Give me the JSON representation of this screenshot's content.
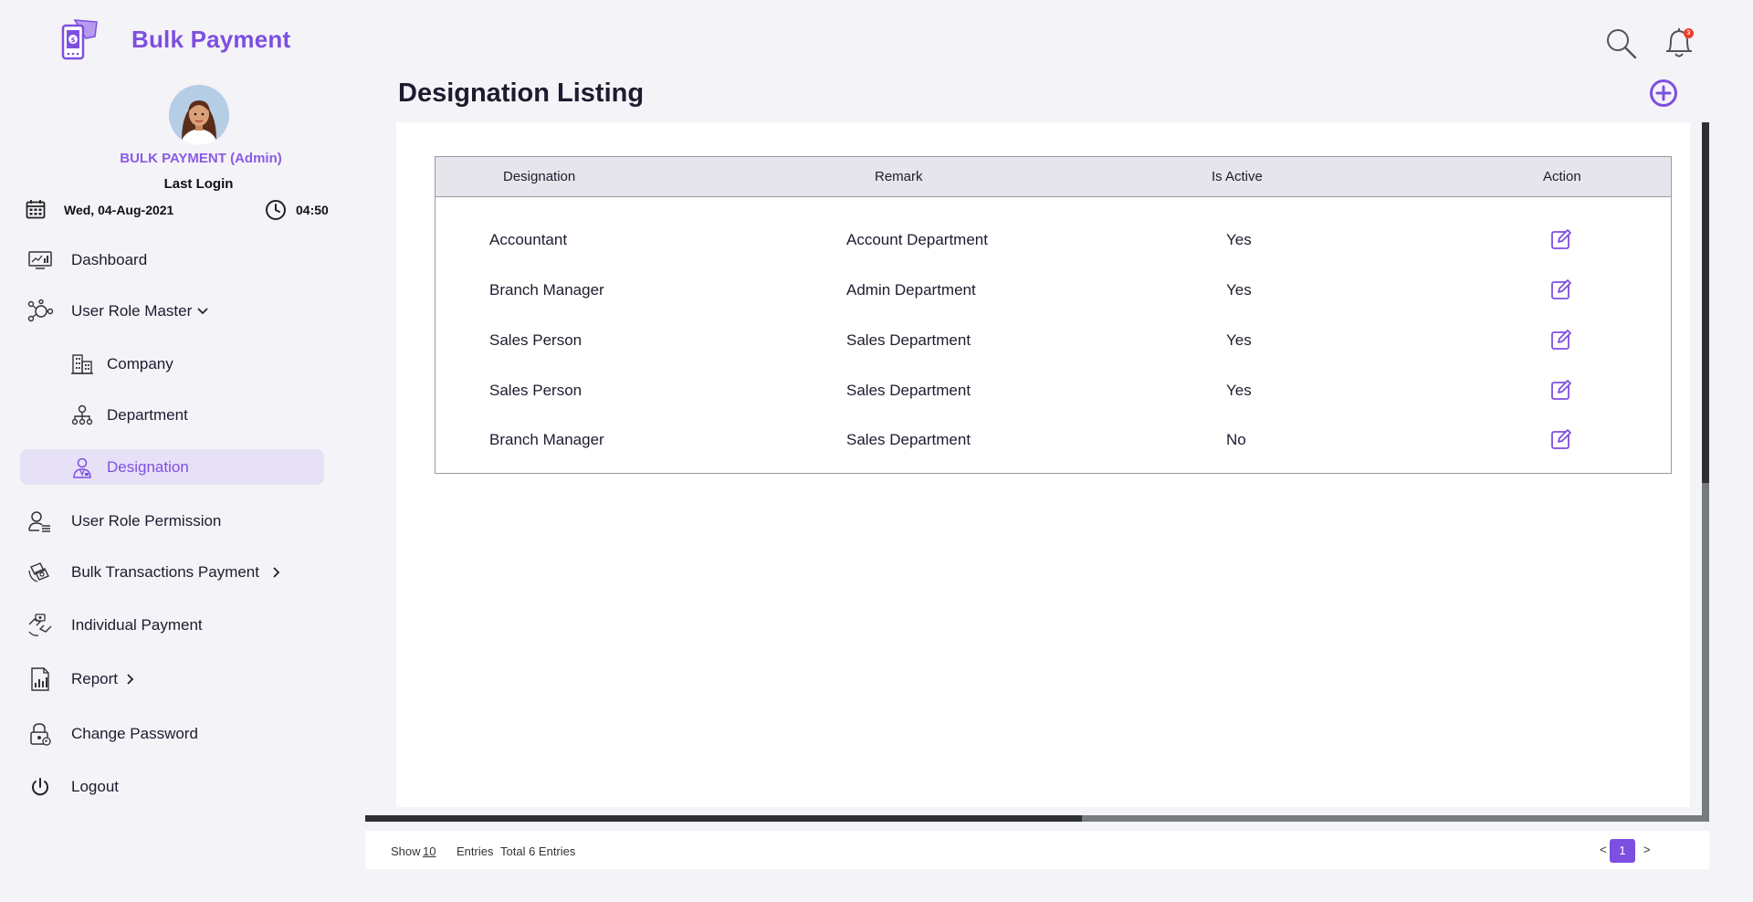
{
  "brand": {
    "name": "Bulk Payment"
  },
  "user": {
    "name": "BULK PAYMENT (Admin)",
    "last_login_label": "Last Login",
    "date": "Wed, 04-Aug-2021",
    "time": "04:50"
  },
  "nav": {
    "dashboard": "Dashboard",
    "user_role_master": "User Role Master",
    "company": "Company",
    "department": "Department",
    "designation": "Designation",
    "user_role_permission": "User Role Permission",
    "bulk_transactions_payment": "Bulk Transactions Payment",
    "individual_payment": "Individual Payment",
    "report": "Report",
    "change_password": "Change Password",
    "logout": "Logout"
  },
  "header": {
    "notification_count": "3"
  },
  "page": {
    "title": "Designation Listing"
  },
  "table": {
    "columns": [
      "Designation",
      "Remark",
      "Is Active",
      "Action"
    ],
    "rows": [
      {
        "designation": "Accountant",
        "remark": "Account Department",
        "is_active": "Yes"
      },
      {
        "designation": "Branch Manager",
        "remark": "Admin Department",
        "is_active": "Yes"
      },
      {
        "designation": "Sales Person",
        "remark": "Sales Department",
        "is_active": "Yes"
      },
      {
        "designation": "Sales Person",
        "remark": "Sales Department",
        "is_active": "Yes"
      },
      {
        "designation": "Branch Manager",
        "remark": "Sales Department",
        "is_active": "No"
      }
    ]
  },
  "footer": {
    "show_label": "Show",
    "show_value": "10",
    "entries_label": "Entries",
    "total_label": "Total 6 Entries",
    "prev": "<",
    "current_page": "1",
    "next": ">"
  },
  "colors": {
    "accent": "#7d4fe0",
    "active_bg": "#e7e1f8",
    "header_bg": "#e6e5ec",
    "page_bg": "#f4f3f8"
  },
  "icons": [
    "wallet-phone-logo-icon",
    "calendar-icon",
    "clock-icon",
    "dashboard-icon",
    "user-role-icon",
    "chevron-down-icon",
    "company-icon",
    "department-icon",
    "designation-icon",
    "user-permission-icon",
    "bulk-transaction-icon",
    "chevron-right-icon",
    "individual-payment-icon",
    "report-icon",
    "change-password-icon",
    "power-icon",
    "search-icon",
    "bell-icon",
    "add-circle-icon",
    "edit-icon"
  ]
}
